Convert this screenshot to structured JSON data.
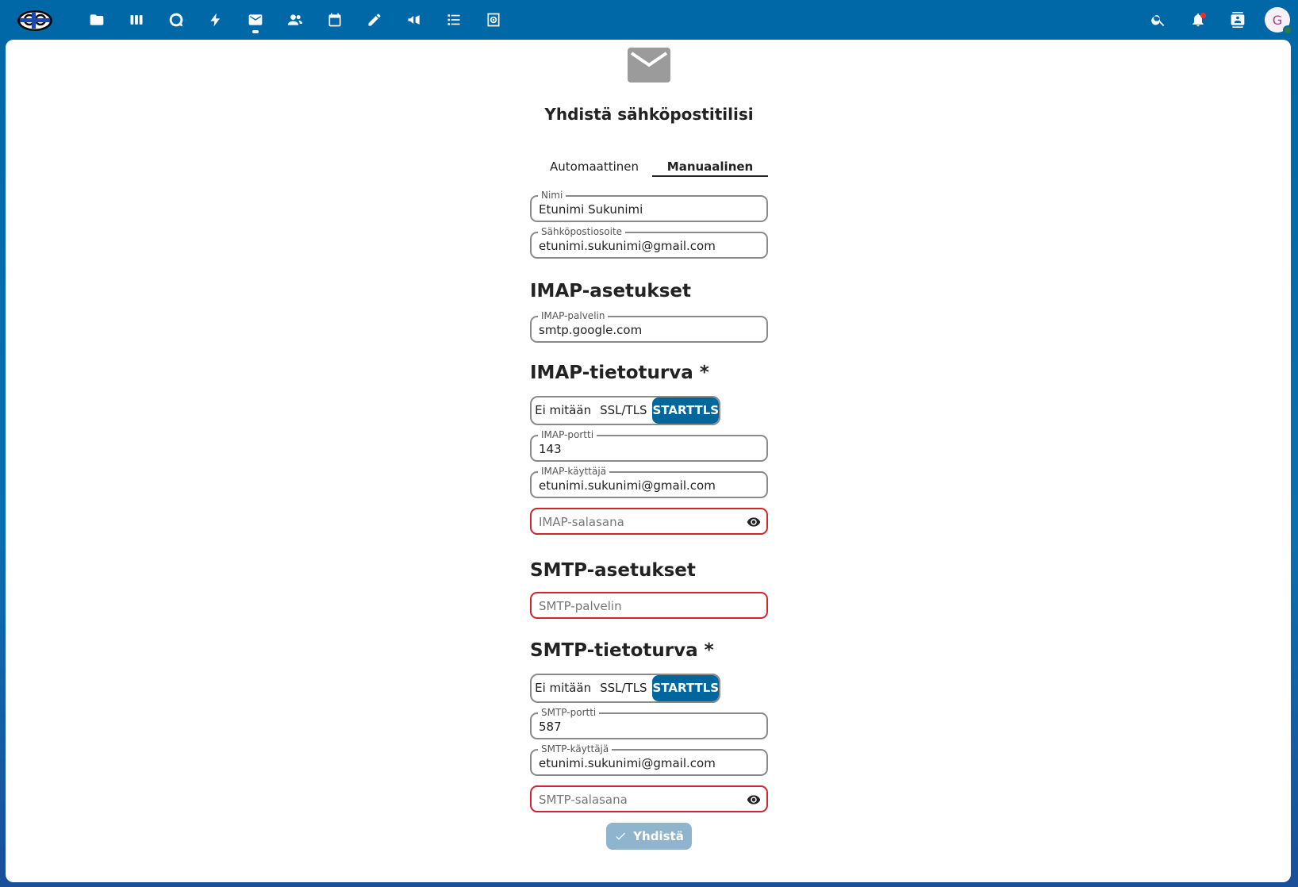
{
  "header": {
    "apps": [
      {
        "icon": "folder-icon",
        "name": "files"
      },
      {
        "icon": "deck-icon",
        "name": "deck"
      },
      {
        "icon": "talk-icon",
        "name": "talk"
      },
      {
        "icon": "activity-icon",
        "name": "activity"
      },
      {
        "icon": "mail-icon",
        "name": "mail",
        "active": true
      },
      {
        "icon": "contacts-icon",
        "name": "contacts"
      },
      {
        "icon": "calendar-icon",
        "name": "calendar"
      },
      {
        "icon": "notes-icon",
        "name": "notes"
      },
      {
        "icon": "announcement-icon",
        "name": "announcements"
      },
      {
        "icon": "tasks-icon",
        "name": "tasks"
      },
      {
        "icon": "admin-icon",
        "name": "admin"
      }
    ],
    "avatar_initial": "G",
    "accent": "#00679e"
  },
  "page": {
    "title": "Yhdistä sähköpostitilisi",
    "tabs": [
      "Automaattinen",
      "Manuaalinen"
    ],
    "active_tab": "Manuaalinen"
  },
  "fields": {
    "name": {
      "label": "Nimi",
      "value": "Etunimi Sukunimi"
    },
    "email": {
      "label": "Sähköpostiosoite",
      "value": "etunimi.sukunimi@gmail.com"
    },
    "imap_host": {
      "label": "IMAP-palvelin",
      "value": "smtp.google.com"
    },
    "imap_port": {
      "label": "IMAP-portti",
      "value": "143"
    },
    "imap_user": {
      "label": "IMAP-käyttäjä",
      "value": "etunimi.sukunimi@gmail.com"
    },
    "imap_password": {
      "placeholder": "IMAP-salasana"
    },
    "smtp_host": {
      "placeholder": "SMTP-palvelin"
    },
    "smtp_port": {
      "label": "SMTP-portti",
      "value": "587"
    },
    "smtp_user": {
      "label": "SMTP-käyttäjä",
      "value": "etunimi.sukunimi@gmail.com"
    },
    "smtp_password": {
      "placeholder": "SMTP-salasana"
    }
  },
  "sections": {
    "imap_settings": "IMAP-asetukset",
    "imap_security": "IMAP-tietoturva *",
    "smtp_settings": "SMTP-asetukset",
    "smtp_security": "SMTP-tietoturva *"
  },
  "security_options": [
    "Ei mitään",
    "SSL/TLS",
    "STARTTLS"
  ],
  "imap_security_selected": "STARTTLS",
  "smtp_security_selected": "STARTTLS",
  "connect_label": "Yhdistä"
}
